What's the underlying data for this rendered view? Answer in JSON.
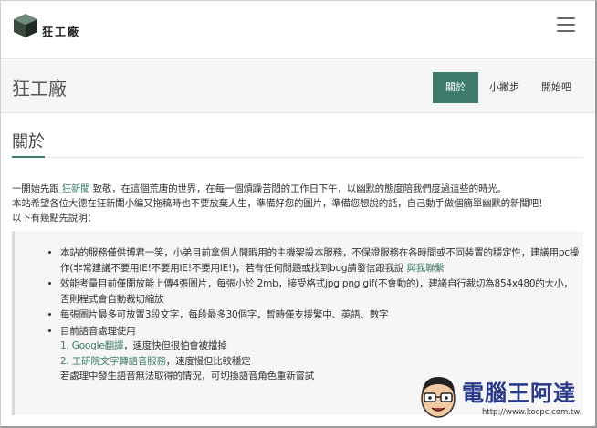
{
  "logo": {
    "text": "狂工廠"
  },
  "header": {
    "site_title": "狂工廠",
    "nav": [
      {
        "label": "關於",
        "active": true
      },
      {
        "label": "小撇步",
        "active": false
      },
      {
        "label": "開始吧",
        "active": false
      }
    ]
  },
  "main": {
    "section_title": "關於",
    "intro": {
      "line1_prefix": "一開始先跟 ",
      "line1_link": "狂新聞",
      "line1_suffix": " 致敬，在這個荒唐的世界，在每一個煩躁苦悶的工作日下午，以幽默的態度陪我們度過這些的時光。",
      "line2": "本站希望各位大德在狂新聞小編又拖稿時也不要放棄人生，準備好您的圖片，準備您想說的話，自己動手做個簡單幽默的新聞吧！",
      "line3": "以下有幾點先說明："
    },
    "notes": {
      "item1_text": "本站的服務僅供博君一笑，小弟目前拿個人閒暇用的主機架設本服務，不保證服務在各時間或不同裝置的穩定性，建議用pc操作(非常建議不要用IE!不要用IE!不要用IE!)，若有任何問題或找到bug請發信跟我說 ",
      "item1_link": "與我聯繫",
      "item2": "效能考量目前僅開放能上傳4張圖片，每張小於 2mb，接受格式jpg png gif(不會動的)，建議自行裁切為854x480的大小，否則程式會自動裁切縮放",
      "item3": "每張圖片最多可放置3段文字，每段最多30個字，暫時僅支援繁中、英語、數字",
      "item4": "目前語音處理使用",
      "sub1_num": "1.",
      "sub1_link": "Google翻譯",
      "sub1_text": "，速度快但很怕會被擋掉",
      "sub2_num": "2.",
      "sub2_link": "工研院文字轉語音服務",
      "sub2_text": "，速度慢但比較穩定",
      "tail": "若處理中發生語音無法取得的情況，可切換語音角色重新嘗試"
    }
  },
  "watermark": {
    "title": "電腦王阿達",
    "url": "http://www.kocpc.com.tw"
  },
  "colors": {
    "accent": "#3f7b6c",
    "band": "#f5f5f5",
    "quote_bg": "#f6f6f6",
    "watermark": "#2a3a8a"
  }
}
